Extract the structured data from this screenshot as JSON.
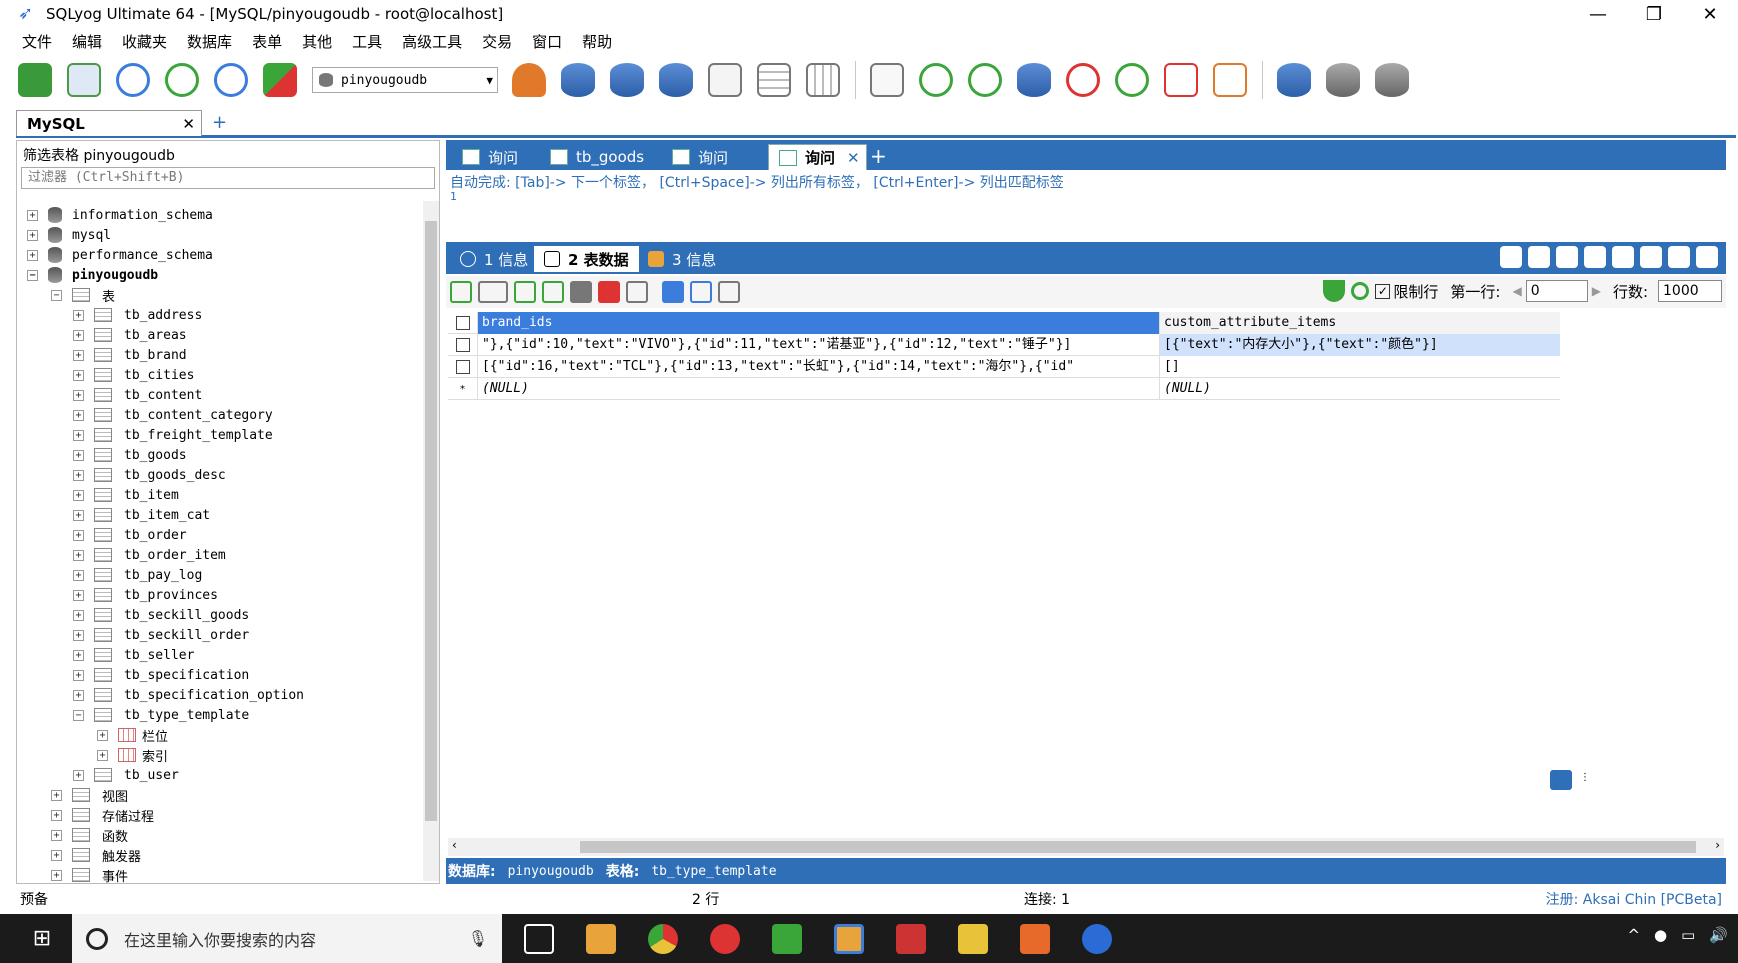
{
  "window": {
    "title": "SQLyog Ultimate 64 - [MySQL/pinyougoudb - root@localhost]",
    "minimize": "—",
    "restore": "❐",
    "close": "✕"
  },
  "menu": [
    "文件",
    "编辑",
    "收藏夹",
    "数据库",
    "表单",
    "其他",
    "工具",
    "高级工具",
    "交易",
    "窗口",
    "帮助"
  ],
  "toolbar": {
    "db_select_value": "pinyougoudb"
  },
  "connection_tab": {
    "label": "MySQL",
    "close": "✕",
    "add": "+"
  },
  "left_panel": {
    "filter_label": "筛选表格 pinyougoudb",
    "filter_placeholder": "过滤器 (Ctrl+Shift+B)",
    "databases": [
      "information_schema",
      "mysql",
      "performance_schema",
      "pinyougoudb"
    ],
    "tables_folder": "表",
    "tables": [
      "tb_address",
      "tb_areas",
      "tb_brand",
      "tb_cities",
      "tb_content",
      "tb_content_category",
      "tb_freight_template",
      "tb_goods",
      "tb_goods_desc",
      "tb_item",
      "tb_item_cat",
      "tb_order",
      "tb_order_item",
      "tb_pay_log",
      "tb_provinces",
      "tb_seckill_goods",
      "tb_seckill_order",
      "tb_seller",
      "tb_specification",
      "tb_specification_option",
      "tb_type_template"
    ],
    "template_children": [
      "栏位",
      "索引"
    ],
    "last_table": "tb_user",
    "folders": [
      "视图",
      "存储过程",
      "函数",
      "触发器",
      "事件"
    ]
  },
  "query_tabs": [
    {
      "label": "询问",
      "active": false
    },
    {
      "label": "tb_goods",
      "active": false
    },
    {
      "label": "询问",
      "active": false
    },
    {
      "label": "询问",
      "active": true
    }
  ],
  "query_tab_close": "✕",
  "query_tab_add": "+",
  "editor": {
    "hint": "自动完成: [Tab]-> 下一个标签， [Ctrl+Space]-> 列出所有标签， [Ctrl+Enter]-> 列出匹配标签",
    "line_number": "1"
  },
  "result_tabs": [
    {
      "label": "1 信息",
      "active": false
    },
    {
      "label": "2 表数据",
      "active": true
    },
    {
      "label": "3 信息",
      "active": false
    }
  ],
  "grid_toolbar": {
    "limit_label": "限制行",
    "limit_checked": "✓",
    "first_row_label": "第一行:",
    "first_row_value": "0",
    "rows_label": "行数:",
    "rows_value": "1000",
    "prev": "◀",
    "next": "▶"
  },
  "grid": {
    "columns": [
      "brand_ids",
      "custom_attribute_items"
    ],
    "rows": [
      [
        "\"},{\"id\":10,\"text\":\"VIVO\"},{\"id\":11,\"text\":\"诺基亚\"},{\"id\":12,\"text\":\"锤子\"}]",
        "[{\"text\":\"内存大小\"},{\"text\":\"颜色\"}]"
      ],
      [
        "[{\"id\":16,\"text\":\"TCL\"},{\"id\":13,\"text\":\"长虹\"},{\"id\":14,\"text\":\"海尔\"},{\"id\"",
        "[]"
      ],
      [
        "(NULL)",
        "(NULL)"
      ]
    ],
    "new_row_marker": "*"
  },
  "info_bar": {
    "db_label": "数据库:",
    "db_value": "pinyougoudb",
    "table_label": "表格:",
    "table_value": "tb_type_template"
  },
  "status_bar": {
    "left": "预备",
    "rows": "2 行",
    "connections": "连接: 1",
    "register": "注册: Aksai Chin [PCBeta]"
  },
  "taskbar": {
    "search_placeholder": "在这里输入你要搜索的内容"
  },
  "colors": {
    "accent": "#2f6fb7",
    "header_selected": "#3b7ddd"
  }
}
